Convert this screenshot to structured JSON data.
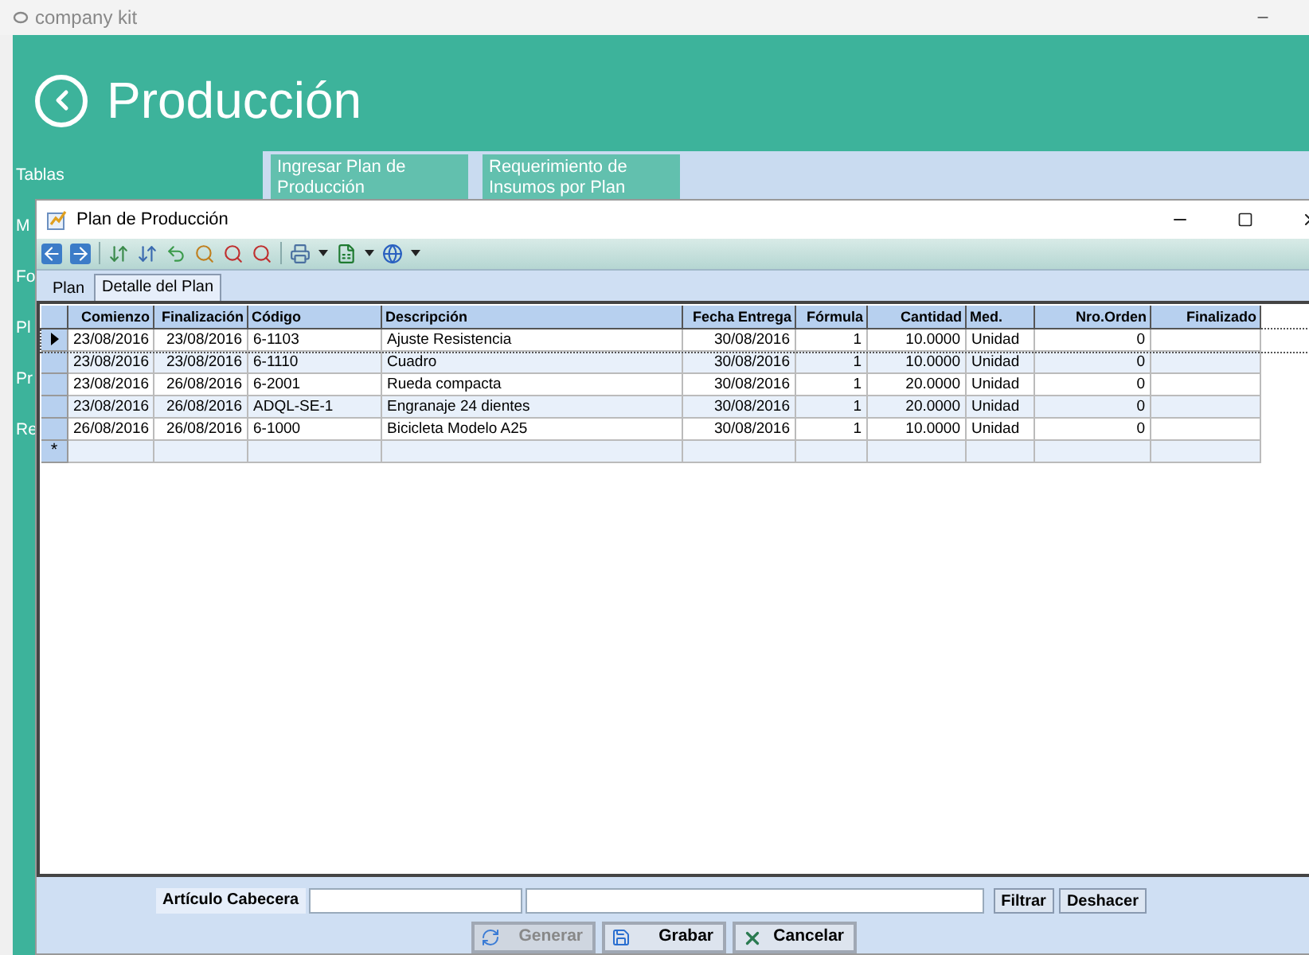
{
  "app_window": {
    "title": "company kit"
  },
  "header": {
    "title": "Producción"
  },
  "sidebar": {
    "items": [
      "Tablas",
      "M",
      "Fo",
      "Pl",
      "Pr",
      "Re"
    ]
  },
  "tiles": [
    "Ingresar Plan de Producción",
    "Requerimiento de Insumos por Plan"
  ],
  "dialog": {
    "title": "Plan de Producción",
    "tabs": [
      {
        "label": "Plan",
        "selected": false
      },
      {
        "label": "Detalle del Plan",
        "selected": true
      }
    ],
    "table": {
      "columns": [
        "Comienzo",
        "Finalización",
        "Código",
        "Descripción",
        "Fecha Entrega",
        "Fórmula",
        "Cantidad",
        "Med.",
        "Nro.Orden",
        "Finalizado"
      ],
      "rows": [
        {
          "selected": true,
          "cells": [
            "23/08/2016",
            "23/08/2016",
            "6-1103",
            "Ajuste Resistencia",
            "30/08/2016",
            "1",
            "10.0000",
            "Unidad",
            "0"
          ]
        },
        {
          "selected": false,
          "cells": [
            "23/08/2016",
            "23/08/2016",
            "6-1110",
            "Cuadro",
            "30/08/2016",
            "1",
            "10.0000",
            "Unidad",
            "0"
          ]
        },
        {
          "selected": false,
          "cells": [
            "23/08/2016",
            "26/08/2016",
            "6-2001",
            "Rueda compacta",
            "30/08/2016",
            "1",
            "20.0000",
            "Unidad",
            "0"
          ]
        },
        {
          "selected": false,
          "cells": [
            "23/08/2016",
            "26/08/2016",
            "ADQL-SE-1",
            "Engranaje 24 dientes",
            "30/08/2016",
            "1",
            "20.0000",
            "Unidad",
            "0"
          ]
        },
        {
          "selected": false,
          "cells": [
            "26/08/2016",
            "26/08/2016",
            "6-1000",
            "Bicicleta Modelo A25",
            "30/08/2016",
            "1",
            "10.0000",
            "Unidad",
            "0"
          ]
        }
      ],
      "new_row_marker": "*"
    },
    "filter": {
      "label": "Artículo Cabecera",
      "buttons": [
        "Filtrar",
        "Deshacer"
      ]
    },
    "actions": [
      {
        "label": "Generar",
        "kind": "generate",
        "disabled": true
      },
      {
        "label": "Grabar",
        "kind": "save",
        "disabled": false
      },
      {
        "label": "Cancelar",
        "kind": "cancel",
        "disabled": false
      }
    ]
  }
}
